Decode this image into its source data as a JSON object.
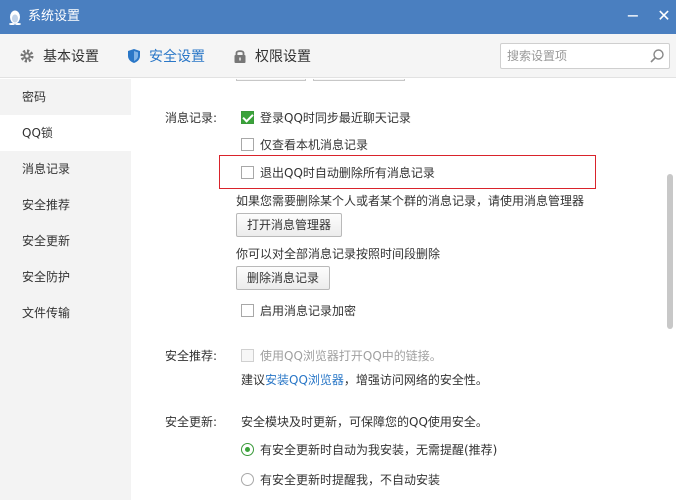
{
  "window": {
    "title": "系统设置",
    "minimize_glyph": "−",
    "close_glyph": "✕",
    "title_icon": "penguin-icon",
    "accent": "#4a7fc0"
  },
  "tabs": [
    {
      "label": "基本设置",
      "icon": "gear-icon"
    },
    {
      "label": "安全设置",
      "icon": "shield-icon",
      "active": true
    },
    {
      "label": "权限设置",
      "icon": "lock-icon"
    }
  ],
  "search": {
    "placeholder": "搜索设置项",
    "icon": "search-icon"
  },
  "sidebar": {
    "items": [
      {
        "label": "密码"
      },
      {
        "label": "QQ锁",
        "active": true
      },
      {
        "label": "消息记录"
      },
      {
        "label": "安全推荐"
      },
      {
        "label": "安全更新"
      },
      {
        "label": "安全防护"
      },
      {
        "label": "文件传输"
      }
    ]
  },
  "message_record": {
    "label": "消息记录:",
    "opt_sync": {
      "label": "登录QQ时同步最近聊天记录",
      "checked": true
    },
    "opt_local_only": {
      "label": "仅查看本机消息记录",
      "checked": false
    },
    "opt_delete_on_exit": {
      "label": "退出QQ时自动删除所有消息记录",
      "checked": false
    },
    "manager_hint": "如果您需要删除某个人或者某个群的消息记录，请使用消息管理器",
    "open_manager_button": "打开消息管理器",
    "delete_hint": "你可以对全部消息记录按照时间段删除",
    "delete_button": "删除消息记录",
    "opt_encrypt": {
      "label": "启用消息记录加密",
      "checked": false
    }
  },
  "safe_recommend": {
    "label": "安全推荐:",
    "opt_browser": {
      "label": "使用QQ浏览器打开QQ中的链接。",
      "checked": false,
      "disabled": true
    },
    "tip_prefix": "建议",
    "tip_link": "安装QQ浏览器",
    "tip_suffix": "，增强访问网络的安全性。"
  },
  "safe_update": {
    "label": "安全更新:",
    "desc": "安全模块及时更新，可保障您的QQ使用安全。",
    "radio_auto": {
      "label": "有安全更新时自动为我安装，无需提醒(推荐)",
      "checked": true
    },
    "radio_notify": {
      "label": "有安全更新时提醒我，不自动安装",
      "checked": false
    }
  },
  "colors": {
    "link": "#2a77c7",
    "check_green": "#3aa33a",
    "highlight_red": "#d9232b"
  }
}
